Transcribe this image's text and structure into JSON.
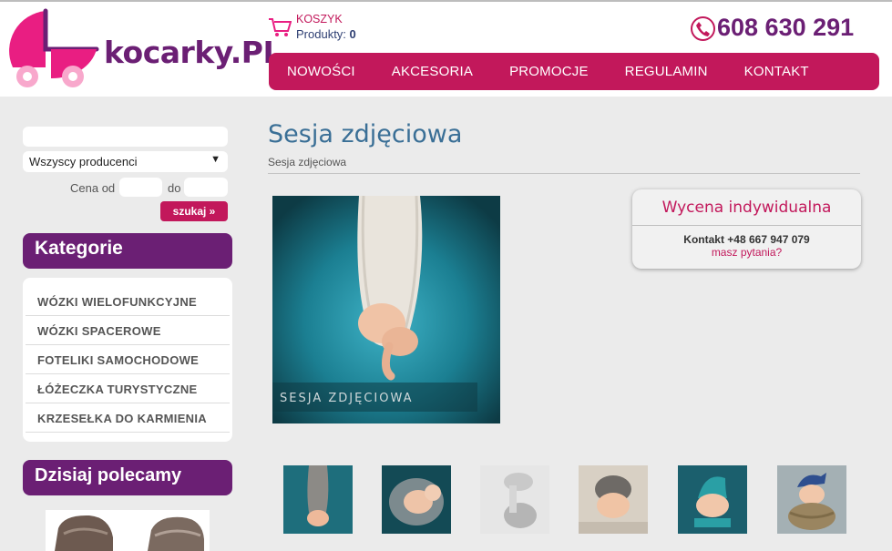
{
  "header": {
    "logo_text": "kocarky.PL",
    "cart": {
      "title": "KOSZYK",
      "count_label": "Produkty:",
      "count": "0"
    },
    "phone": "608 630 291",
    "nav": [
      "NOWOŚCI",
      "AKCESORIA",
      "PROMOCJE",
      "REGULAMIN",
      "KONTAKT"
    ]
  },
  "sidebar": {
    "search": {
      "value": "",
      "placeholder": ""
    },
    "producer_select": "Wszyscy producenci",
    "price_from_label": "Cena od",
    "price_to_label": "do",
    "search_button": "szukaj »",
    "categories_title": "Kategorie",
    "categories": [
      "WÓZKI WIELOFUNKCYJNE",
      "WÓZKI SPACEROWE",
      "FOTELIKI SAMOCHODOWE",
      "ŁÓŻECZKA TURYSTYCZNE",
      "KRZESEŁKA DO KARMIENIA"
    ],
    "recommended_title": "Dzisiaj polecamy"
  },
  "main": {
    "title": "Sesja zdjęciowa",
    "breadcrumb": "Sesja zdjęciowa",
    "image_caption": "SESJA ZDJĘCIOWA",
    "quote": {
      "title": "Wycena indywidualna",
      "contact_label": "Kontakt",
      "contact_phone": "+48 667 947 079",
      "question": "masz pytania?"
    },
    "thumbnails": [
      "newborn-sling-blue",
      "newborn-nest-teal",
      "newborn-bw-hands",
      "newborn-knit-hat",
      "newborn-teal-elf-hat",
      "newborn-basket-blue-hat"
    ]
  },
  "colors": {
    "brand_magenta": "#c2185b",
    "brand_purple": "#6b1f74",
    "title_blue": "#3a6f96",
    "background": "#ebebeb"
  }
}
